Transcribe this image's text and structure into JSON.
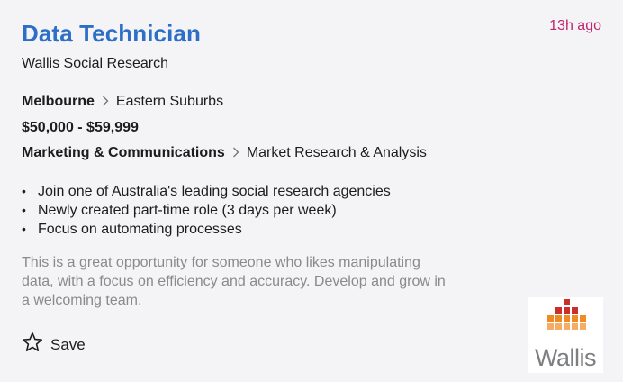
{
  "job": {
    "title": "Data Technician",
    "posted": "13h ago",
    "company": "Wallis Social Research",
    "location": {
      "city": "Melbourne",
      "area": "Eastern Suburbs"
    },
    "salary": "$50,000 - $59,999",
    "classification": {
      "category": "Marketing & Communications",
      "subcategory": "Market Research & Analysis"
    },
    "bullets": [
      "Join one of Australia's leading social research agencies",
      "Newly created part-time role (3 days per week)",
      "Focus on automating processes"
    ],
    "description_lines": [
      "This is a great opportunity for someone who likes manipulating",
      "data, with a focus on efficiency and accuracy. Develop and grow in",
      "a welcoming team."
    ]
  },
  "actions": {
    "save_label": "Save",
    "save_icon": "star-outline-icon"
  },
  "logo": {
    "text": "Wallis"
  },
  "colors": {
    "title": "#2d6fc7",
    "time": "#c0256e",
    "description": "#8a8a8a",
    "logo_red": "#c9302c",
    "logo_orange": "#f08a24",
    "logo_light_orange": "#f5ad63"
  }
}
